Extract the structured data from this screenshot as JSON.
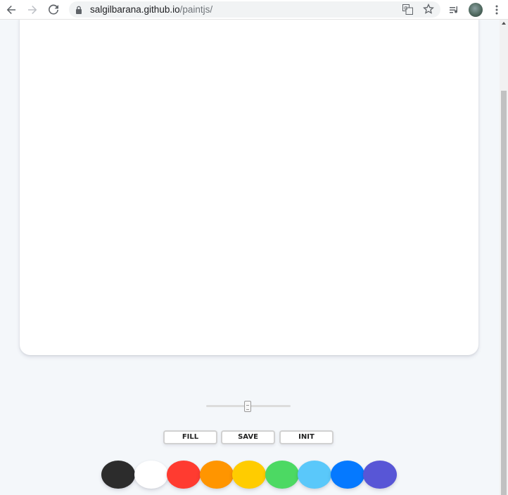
{
  "browser": {
    "url_host": "salgilbarana.github.io",
    "url_path": "/paintjs/",
    "icons": {
      "back": "arrow-left-icon",
      "forward": "arrow-right-icon",
      "reload": "reload-icon",
      "lock": "lock-icon",
      "translate": "translate-icon",
      "bookmark": "star-icon",
      "media": "media-queue-icon",
      "menu": "kebab-menu-icon"
    }
  },
  "controls": {
    "fill_label": "FILL",
    "save_label": "SAVE",
    "init_label": "INIT",
    "brush_size": {
      "min": 0.1,
      "max": 5,
      "value": 2.5
    }
  },
  "palette": [
    {
      "name": "black",
      "color": "#2c2c2c"
    },
    {
      "name": "white",
      "color": "#ffffff"
    },
    {
      "name": "red",
      "color": "#ff3b30"
    },
    {
      "name": "orange",
      "color": "#ff9500"
    },
    {
      "name": "yellow",
      "color": "#ffcc00"
    },
    {
      "name": "green",
      "color": "#4cd963"
    },
    {
      "name": "light-blue",
      "color": "#5ac8fa"
    },
    {
      "name": "blue",
      "color": "#0579ff"
    },
    {
      "name": "purple",
      "color": "#5856d6"
    }
  ]
}
